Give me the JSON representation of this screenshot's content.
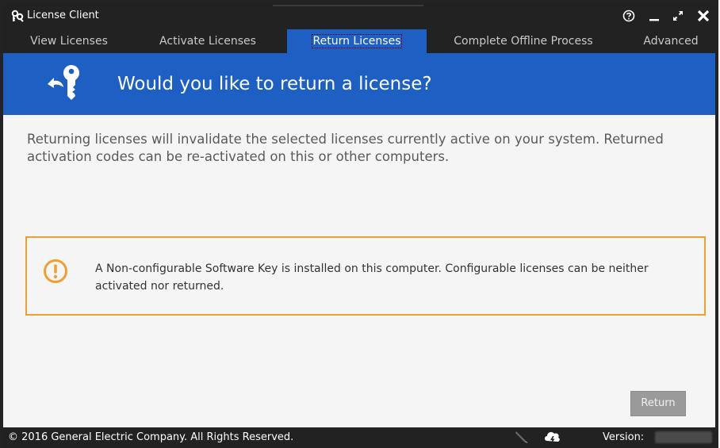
{
  "window": {
    "title": "License Client"
  },
  "tabs": [
    {
      "label": "View Licenses"
    },
    {
      "label": "Activate Licenses"
    },
    {
      "label": "Return Licenses"
    },
    {
      "label": "Complete Offline Process"
    },
    {
      "label": "Advanced"
    }
  ],
  "active_tab": "Return Licenses",
  "banner": {
    "title": "Would you like to return a license?",
    "icon": "key-return-icon"
  },
  "main": {
    "description": "Returning licenses will invalidate the selected licenses currently active on your system. Returned activation codes can be re-activated on this or other computers.",
    "notice": {
      "icon": "warning-icon",
      "text": "A Non-configurable Software Key is installed on this computer. Configurable licenses can be neither activated nor returned."
    },
    "return_button": "Return"
  },
  "footer": {
    "copyright": "© 2016 General Electric Company.  All Rights Reserved.",
    "version_label": "Version:"
  },
  "colors": {
    "accent_blue": "#1e5fc3",
    "window_dark": "#222222",
    "warning_orange": "#f0a030",
    "disabled_button": "#9a9a9a"
  }
}
